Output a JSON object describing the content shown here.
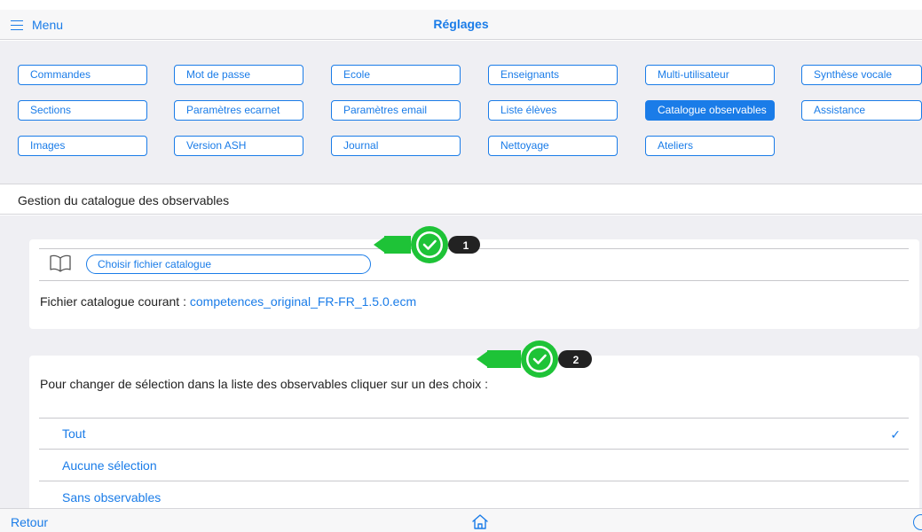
{
  "nav": {
    "menu_label": "Menu",
    "title": "Réglages"
  },
  "tabs": [
    "Commandes",
    "Mot de passe",
    "Ecole",
    "Enseignants",
    "Multi-utilisateur",
    "Synthèse vocale",
    "Sections",
    "Paramètres ecarnet",
    "Paramètres email",
    "Liste élèves",
    "Catalogue observables",
    "Assistance",
    "Images",
    "Version ASH",
    "Journal",
    "Nettoyage",
    "Ateliers"
  ],
  "active_tab": "Catalogue observables",
  "section": {
    "title": "Gestion du catalogue des observables"
  },
  "catalogue": {
    "choose_button": "Choisir fichier catalogue",
    "current_label": "Fichier catalogue courant :",
    "current_file": "competences_original_FR-FR_1.5.0.ecm"
  },
  "badges": [
    "1",
    "2"
  ],
  "selection": {
    "instruction": "Pour changer de sélection dans la liste des observables cliquer sur un des choix :",
    "options": [
      "Tout",
      "Aucune sélection",
      "Sans observables"
    ],
    "selected": "Tout"
  },
  "footer": {
    "back_label": "Retour"
  },
  "colors": {
    "accent": "#1a7ce8",
    "badge_green": "#1ec337",
    "badge_dark": "#222222",
    "background": "#efeff3"
  },
  "icons": [
    "hamburger-icon",
    "book-icon",
    "checkmark-badge-icon",
    "check-icon",
    "home-icon",
    "help-icon"
  ]
}
